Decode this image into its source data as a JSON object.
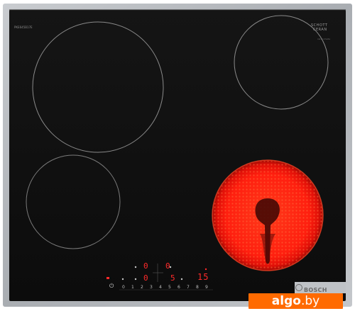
{
  "product": {
    "brand": "BOSCH",
    "model_code": "PKE645B17E",
    "certificate_lines": [
      "SCHOTT",
      "CERAN"
    ],
    "certificate_small": "ceran made"
  },
  "control_panel": {
    "zone_display_left_top": "0",
    "zone_display_left_bottom": "0",
    "zone_display_right_top": "0",
    "zone_display_right_bottom": "5",
    "timer_display": "15",
    "power_symbol": "⏻",
    "slider_numbers": [
      "0",
      "1",
      "2",
      "3",
      "4",
      "5",
      "6",
      "7",
      "8",
      "9"
    ]
  },
  "watermark": {
    "name": "algo",
    "domain": ".by"
  },
  "colors": {
    "frame": "#b4b7bb",
    "glass": "#121212",
    "burner_ring": "#7a7a7a",
    "hot_zone": "#ff1c0f",
    "display": "#ff2a2a",
    "watermark_bg": "#ff6a00"
  }
}
